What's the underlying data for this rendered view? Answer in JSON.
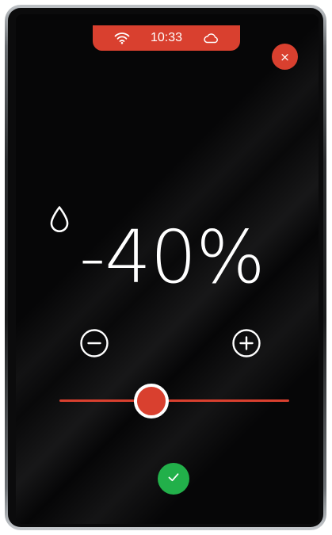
{
  "status_bar": {
    "time": "10:33",
    "wifi_icon": "wifi-icon",
    "cloud_icon": "cloud-icon"
  },
  "close_button": {
    "label": "×",
    "icon": "close-icon"
  },
  "humidity": {
    "icon": "water-drop-icon",
    "value_text": "-40%",
    "slider_fraction": 0.4
  },
  "controls": {
    "minus_icon": "minus-circle-icon",
    "plus_icon": "plus-circle-icon",
    "confirm_icon": "checkmark-icon"
  },
  "colors": {
    "accent": "#d9402f",
    "confirm": "#22b04a",
    "background": "#060607",
    "text": "#ffffff"
  }
}
